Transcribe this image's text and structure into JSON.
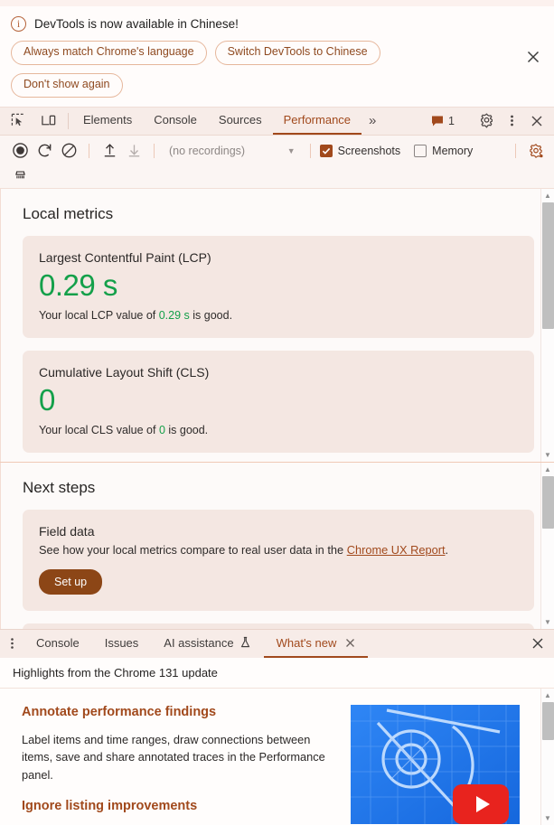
{
  "banner": {
    "message": "DevTools is now available in Chinese!",
    "buttons": [
      {
        "label": "Always match Chrome's language"
      },
      {
        "label": "Switch DevTools to Chinese"
      },
      {
        "label": "Don't show again"
      }
    ],
    "close_label": "×"
  },
  "tabbar": {
    "tabs": [
      {
        "label": "Elements",
        "active": false
      },
      {
        "label": "Console",
        "active": false
      },
      {
        "label": "Sources",
        "active": false
      },
      {
        "label": "Performance",
        "active": true
      }
    ],
    "more_label": "»",
    "issue_count": "1"
  },
  "perf_toolbar": {
    "recordings_placeholder": "(no recordings)",
    "screenshots_label": "Screenshots",
    "screenshots_checked": true,
    "memory_label": "Memory",
    "memory_checked": false
  },
  "local_metrics": {
    "title": "Local metrics",
    "cards": [
      {
        "title": "Largest Contentful Paint (LCP)",
        "value": "0.29 s",
        "desc_prefix": "Your local LCP value of ",
        "desc_value": "0.29 s",
        "desc_suffix": " is good."
      },
      {
        "title": "Cumulative Layout Shift (CLS)",
        "value": "0",
        "desc_prefix": "Your local CLS value of ",
        "desc_value": "0",
        "desc_suffix": " is good."
      }
    ]
  },
  "next_steps": {
    "title": "Next steps",
    "field_data": {
      "title": "Field data",
      "desc_prefix": "See how your local metrics compare to real user data in the ",
      "link": "Chrome UX Report",
      "desc_suffix": ".",
      "button": "Set up"
    }
  },
  "drawer": {
    "tabs": [
      {
        "label": "Console",
        "active": false,
        "closable": false
      },
      {
        "label": "Issues",
        "active": false,
        "closable": false
      },
      {
        "label": "AI assistance",
        "active": false,
        "closable": false,
        "experiment": true
      },
      {
        "label": "What's new",
        "active": true,
        "closable": true
      }
    ],
    "close_label": "×"
  },
  "whats_new": {
    "heading": "Highlights from the Chrome 131 update",
    "items": [
      {
        "title": "Annotate performance findings",
        "body": "Label items and time ranges, draw connections between items, save and share annotated traces in the Performance panel."
      },
      {
        "title": "Ignore listing improvements",
        "body": ""
      }
    ]
  },
  "colors": {
    "accent": "#a1491c",
    "good": "#14a04a",
    "card_bg": "#f4e7e2",
    "button_bg": "#8c4616"
  }
}
